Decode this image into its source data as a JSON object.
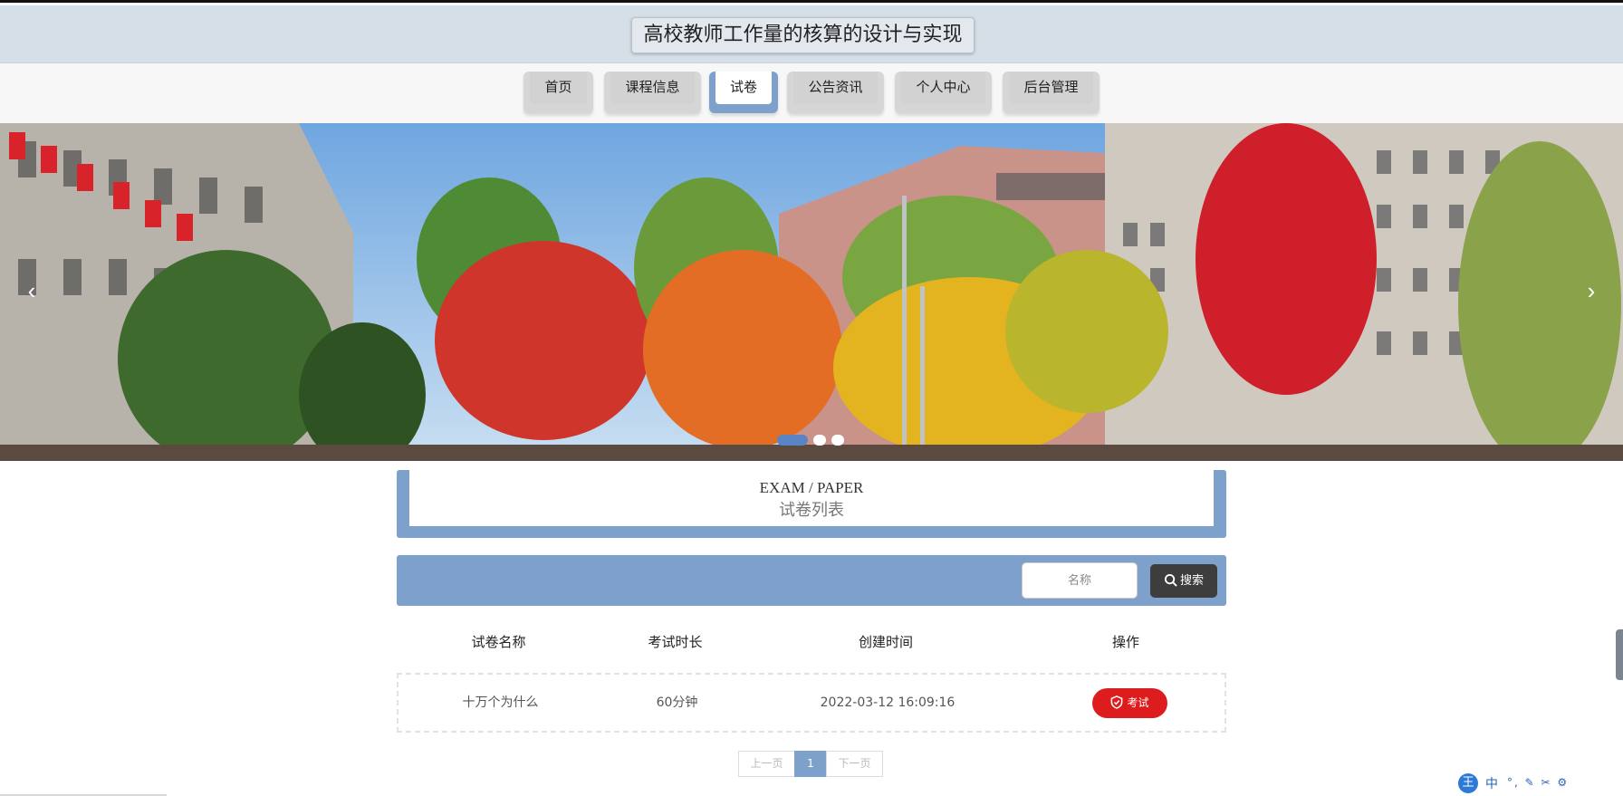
{
  "site": {
    "title": "高校教师工作量的核算的设计与实现"
  },
  "nav": {
    "items": [
      {
        "label": "首页"
      },
      {
        "label": "课程信息"
      },
      {
        "label": "试卷"
      },
      {
        "label": "公告资讯"
      },
      {
        "label": "个人中心"
      },
      {
        "label": "后台管理"
      }
    ],
    "active_index": 2
  },
  "banner": {
    "prev_icon": "chevron-left-icon",
    "next_icon": "chevron-right-icon",
    "slide_count": 3,
    "active_slide": 0
  },
  "section": {
    "title_en": "EXAM / PAPER",
    "title_cn": "试卷列表"
  },
  "search": {
    "placeholder": "名称",
    "value": "",
    "button_label": "搜索",
    "icon": "search-icon"
  },
  "table": {
    "headers": [
      "试卷名称",
      "考试时长",
      "创建时间",
      "操作"
    ],
    "rows": [
      {
        "name": "十万个为什么",
        "duration": "60分钟",
        "created": "2022-03-12 16:09:16",
        "action": "考试",
        "action_icon": "shield-check-icon"
      }
    ]
  },
  "pagination": {
    "prev_label": "上一页",
    "current_page": "1",
    "next_label": "下一页"
  },
  "tray": {
    "logo": "王",
    "ime": "中"
  },
  "colors": {
    "accent": "#7ea1cc",
    "danger": "#dd1d1d",
    "header_bg": "#d6dfe8",
    "search_button": "#3d3d3d"
  }
}
